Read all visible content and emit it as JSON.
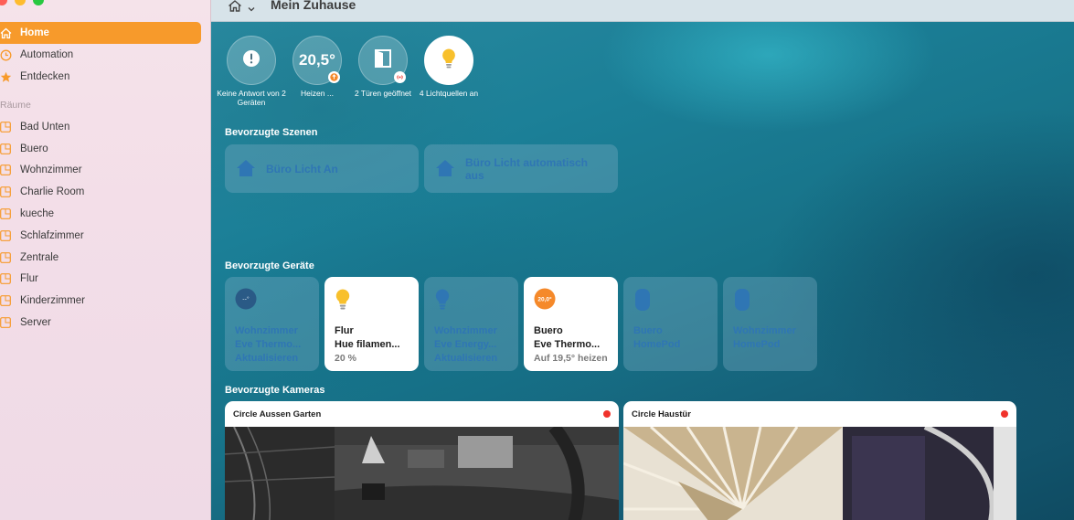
{
  "sidebar": {
    "nav": [
      {
        "label": "Home",
        "icon": "house-icon",
        "active": true
      },
      {
        "label": "Automation",
        "icon": "clock-icon",
        "active": false
      },
      {
        "label": "Entdecken",
        "icon": "star-icon",
        "active": false
      }
    ],
    "rooms_heading": "Räume",
    "rooms": [
      "Bad Unten",
      "Buero",
      "Wohnzimmer",
      "Charlie Room",
      "kueche",
      "Schlafzimmer",
      "Zentrale",
      "Flur",
      "Kinderzimmer",
      "Server"
    ]
  },
  "toolbar": {
    "title": "Mein Zuhause"
  },
  "status": [
    {
      "label": "Keine Antwort von 2 Geräten",
      "icon": "exclamation-icon"
    },
    {
      "value": "20,5°",
      "label": "Heizen ...",
      "icon": "thermostat-icon"
    },
    {
      "label": "2 Türen geöffnet",
      "icon": "door-icon"
    },
    {
      "label": "4 Lichtquellen an",
      "icon": "lightbulb-icon"
    }
  ],
  "sections": {
    "scenes": "Bevorzugte Szenen",
    "devices": "Bevorzugte Geräte",
    "cameras": "Bevorzugte Kameras"
  },
  "scenes": [
    {
      "label": "Büro Licht An"
    },
    {
      "label": "Büro Licht automatisch aus"
    }
  ],
  "devices": [
    {
      "line1": "Wohnzimmer",
      "line2": "Eve Thermo...",
      "line3": "Aktualisieren",
      "badge": "--°",
      "icon": "thermostat-icon",
      "on": false
    },
    {
      "line1": "Flur",
      "line2": "Hue filamen...",
      "line3": "20 %",
      "icon": "lightbulb-icon",
      "on": true
    },
    {
      "line1": "Wohnzimmer",
      "line2": "Eve Energy...",
      "line3": "Aktualisieren",
      "icon": "lightbulb-icon",
      "on": false
    },
    {
      "line1": "Buero",
      "line2": "Eve Thermo...",
      "line3": "Auf 19,5° heizen",
      "badge": "20,0°",
      "icon": "thermostat-icon",
      "on": true
    },
    {
      "line1": "Buero",
      "line2": "HomePod",
      "line3": "",
      "icon": "homepod-icon",
      "on": false
    },
    {
      "line1": "Wohnzimmer",
      "line2": "HomePod",
      "line3": "",
      "icon": "homepod-icon",
      "on": false
    }
  ],
  "cameras": [
    {
      "label": "Circle Aussen Garten"
    },
    {
      "label": "Circle Haustür"
    }
  ],
  "colors": {
    "accent": "#f79a2b",
    "tile_text_off": "#2f76b4",
    "recording": "#f0322b"
  }
}
